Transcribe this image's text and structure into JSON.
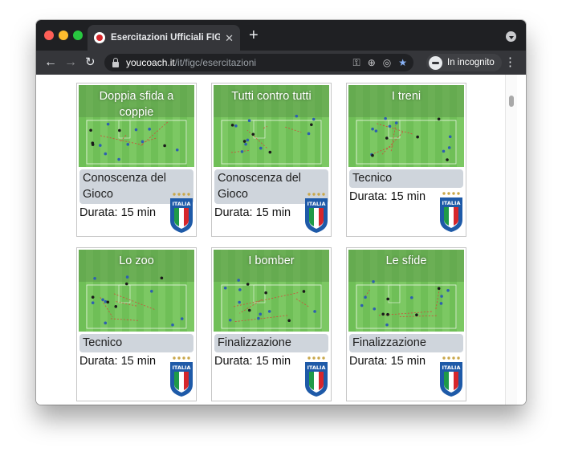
{
  "browser": {
    "tab_title": "Esercitazioni Ufficiali FIGC | Yo",
    "tab_close": "✕",
    "new_tab": "+",
    "url_host": "youcoach.it",
    "url_path": "/it/figc/esercitazioni",
    "incognito_label": "In incognito",
    "nav_back": "←",
    "nav_forward": "→",
    "nav_reload": "↻",
    "menu": "⋮",
    "omnibox_icons": [
      "⚿",
      "⊕",
      "◎",
      "★"
    ]
  },
  "crest_text": "ITALIA",
  "cards": [
    {
      "title": "Doppia sfida a coppie",
      "category": "Conoscenza del Gioco",
      "duration": "Durata: 15 min",
      "category_two_lines": true
    },
    {
      "title": "Tutti contro tutti",
      "category": "Conoscenza del Gioco",
      "duration": "Durata: 15 min",
      "category_two_lines": true
    },
    {
      "title": "I treni",
      "category": "Tecnico",
      "duration": "Durata: 15 min",
      "category_two_lines": false
    },
    {
      "title": "Lo zoo",
      "category": "Tecnico",
      "duration": "Durata: 15 min",
      "category_two_lines": false
    },
    {
      "title": "I bomber",
      "category": "Finalizzazione",
      "duration": "Durata: 15 min",
      "category_two_lines": false
    },
    {
      "title": "Le sfide",
      "category": "Finalizzazione",
      "duration": "Durata: 15 min",
      "category_two_lines": false
    }
  ],
  "colors": {
    "chrome_dark": "#1f2023",
    "chrome_toolbar": "#35363a",
    "category_bg": "#cfd5dc",
    "pitch_green": "#6fbf57",
    "pitch_stripe": "#82cc68",
    "italia_blue": "#1e5aa8"
  }
}
